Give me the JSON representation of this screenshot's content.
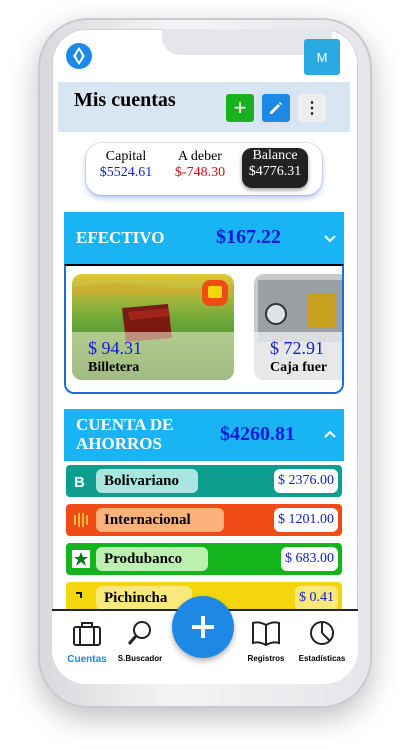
{
  "header": {
    "title": "Mis cuentas",
    "avatar": "M"
  },
  "summary": {
    "capital_label": "Capital",
    "capital_value": "$5524.61",
    "debt_label": "A deber",
    "debt_value": "$-748.30",
    "balance_label": "Balance",
    "balance_value": "$4776.31"
  },
  "groups": [
    {
      "name": "EFECTIVO",
      "total": "$167.22",
      "cards": [
        {
          "amount": "$ 94.31",
          "name": "Billetera"
        },
        {
          "amount": "$ 72.91",
          "name": "Caja fuer"
        }
      ]
    },
    {
      "name_line1": "CUENTA DE",
      "name_line2": "AHORROS",
      "total": "$4260.81",
      "accounts": [
        {
          "name": "Bolivariano",
          "value": "$ 2376.00",
          "color": "#0e9d8e",
          "pill": "#a9e6df"
        },
        {
          "name": "Internacional",
          "value": "$ 1201.00",
          "color": "#f04a16",
          "pill": "#fbb27a"
        },
        {
          "name": "Produbanco",
          "value": "$ 683.00",
          "color": "#14b41c",
          "pill": "#bdf0b0"
        },
        {
          "name": "Pichincha",
          "value": "$ 0.41",
          "color": "#f3d70c",
          "pill": "#f8e97a"
        }
      ]
    }
  ],
  "nav": {
    "cuentas": "Cuentas",
    "buscador": "S.Buscador",
    "registros": "Registros",
    "estadisticas": "Estadísticas"
  },
  "colors": {
    "accent": "#1e88e5",
    "group_header": "#18b4f4",
    "amount_blue": "#1020d0",
    "debt_red": "#d01010"
  }
}
